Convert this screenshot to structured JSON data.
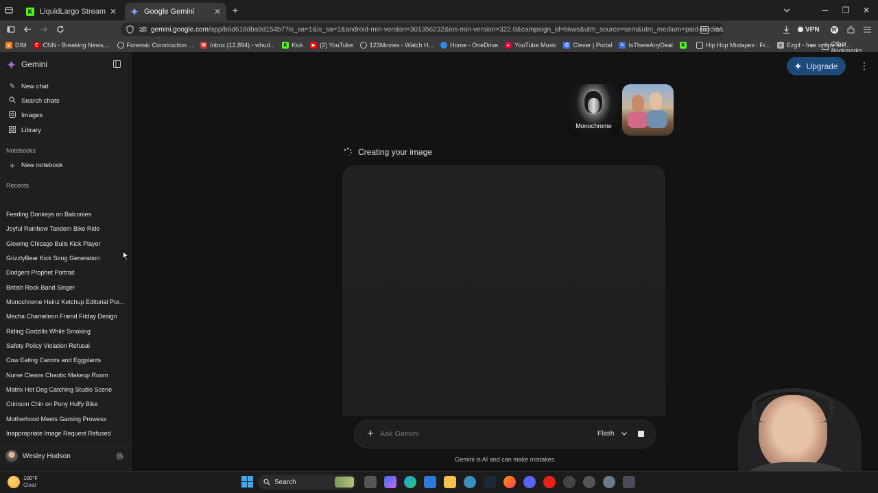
{
  "browser": {
    "tabs": [
      {
        "label": "LiquidLargo Stream - Watch",
        "favicon": "kick-icon",
        "active": false
      },
      {
        "label": "Google Gemini",
        "favicon": "gemini-icon",
        "active": true
      }
    ],
    "url_host": "gemini.google.com",
    "url_rest": "/app/b6d618dba9d154b7?is_sa=1&is_sa=1&android-min-version=301356232&ios-min-version=322.0&campaign_id=bkws&utm_source=sem&utm_medium=paid-media&utm",
    "vpn_label": "VPN",
    "bookmarks": [
      {
        "label": "DIM",
        "icon": "fire-icon",
        "color": "#ff7a1a"
      },
      {
        "label": "CNN - Breaking News,...",
        "icon": "cnn-icon",
        "color": "#cc0000"
      },
      {
        "label": "Forensic Construction ...",
        "icon": "globe-icon",
        "color": "#777777"
      },
      {
        "label": "Inbox (12,894) - whud...",
        "icon": "gmail-icon",
        "color": "#d93025"
      },
      {
        "label": "Kick",
        "icon": "kick-icon",
        "color": "#53fc18"
      },
      {
        "label": "(2) YouTube",
        "icon": "youtube-icon",
        "color": "#ff0000"
      },
      {
        "label": "123Movies - Watch H...",
        "icon": "globe-icon",
        "color": "#777777"
      },
      {
        "label": "Home - OneDrive",
        "icon": "cloud-icon",
        "color": "#2a8cf0"
      },
      {
        "label": "YouTube Music",
        "icon": "youtube-music-icon",
        "color": "#ff0033"
      },
      {
        "label": "Clever | Portal",
        "icon": "clever-icon",
        "color": "#4274f6"
      },
      {
        "label": "IsThereAnyDeal",
        "icon": "deal-icon",
        "color": "#3a6fd8"
      },
      {
        "label": "",
        "icon": "kick-icon",
        "color": "#53fc18"
      },
      {
        "label": "Hip Hop Mixtapes : Fr...",
        "icon": "page-icon",
        "color": "#888888"
      },
      {
        "label": "Ezgif - free online ani...",
        "icon": "ezgif-icon",
        "color": "#b0b0b0"
      }
    ],
    "other_bookmarks": "Other Bookmarks"
  },
  "sidebar": {
    "brand": "Gemini",
    "nav": [
      {
        "label": "New chat",
        "icon": "edit-icon"
      },
      {
        "label": "Search chats",
        "icon": "search-icon"
      },
      {
        "label": "Images",
        "icon": "image-icon"
      },
      {
        "label": "Library",
        "icon": "library-icon"
      }
    ],
    "notebooks_label": "Notebooks",
    "new_notebook": "New notebook",
    "recents_label": "Recents",
    "recents": [
      "Feeding Donkeys on Balconies",
      "Joyful Rainbow Tandem Bike Ride",
      "Glowing Chicago Bulls Kick Player",
      "GrizzlyBear Kick Song Generation",
      "Dodgers Prophet Portrait",
      "British Rock Band Singer",
      "Monochrome Heinz Ketchup Editorial Por...",
      "Mecha Chameleon Friend Friday Design",
      "Riding Godzilla While Smoking",
      "Safety Policy Violation Refusal",
      "Cow Eating Carrots and Eggplants",
      "Nurse Cleans Chaotic Makeup Room",
      "Matrix Hot Dog Catching Studio Scene",
      "Crimson Chin on Pony Huffy Bike",
      "Motherhood Meets Gaming Prowess",
      "Inappropriate Image Request Refused"
    ],
    "user_name": "Wesley Hudson"
  },
  "main": {
    "upgrade_label": "Upgrade",
    "style_thumbs": [
      {
        "label": "Monochrome"
      },
      {
        "label": ""
      }
    ],
    "status_text": "Creating your image",
    "composer": {
      "placeholder": "Ask Gemini",
      "model": "Flash"
    },
    "disclaimer": "Gemini is AI and can make mistakes."
  },
  "taskbar": {
    "weather_temp": "100°F",
    "weather_desc": "Clear",
    "search_label": "Search"
  },
  "colors": {
    "accent": "#1c4b7a",
    "background": "#131314",
    "sidebar": "#1e1f20"
  }
}
